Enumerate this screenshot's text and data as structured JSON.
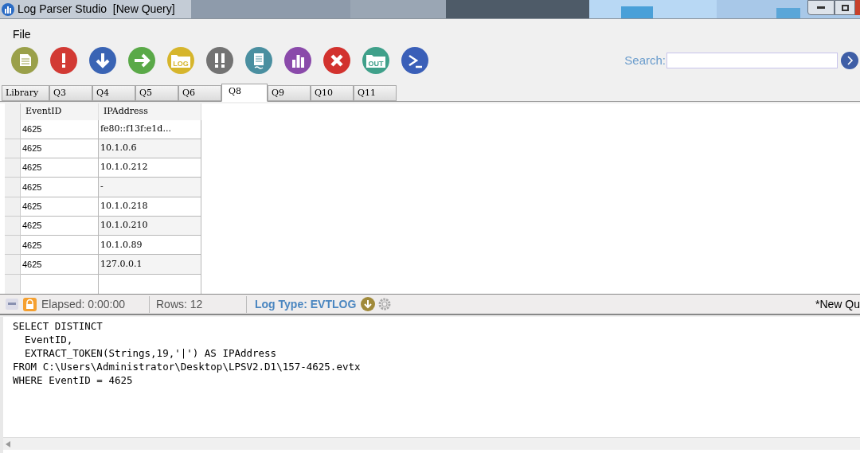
{
  "window": {
    "title": "Log Parser Studio  [New Query]"
  },
  "menu": [
    "File"
  ],
  "toolbar": [
    {
      "kind": "document",
      "color": "#9aa04a"
    },
    {
      "kind": "exclamation",
      "color": "#d23a34"
    },
    {
      "kind": "down-arrow",
      "color": "#3a64b4"
    },
    {
      "kind": "right-arrow",
      "color": "#5aa948"
    },
    {
      "kind": "folder",
      "color": "#d6b52c",
      "label": "LOG"
    },
    {
      "kind": "double-exclamation",
      "color": "#737373"
    },
    {
      "kind": "page",
      "color": "#4a8fa0"
    },
    {
      "kind": "bars",
      "color": "#8a4aaa"
    },
    {
      "kind": "x",
      "color": "#d2322e"
    },
    {
      "kind": "folder",
      "color": "#3fa08a",
      "label": "OUT"
    },
    {
      "kind": "prompt",
      "color": "#3a5fb8"
    }
  ],
  "search": {
    "label": "Search:"
  },
  "tabs": [
    {
      "label": "Library",
      "selected": false
    },
    {
      "label": "Q3",
      "selected": false
    },
    {
      "label": "Q4",
      "selected": false
    },
    {
      "label": "Q5",
      "selected": false
    },
    {
      "label": "Q6",
      "selected": false
    },
    {
      "label": "Q8",
      "selected": true
    },
    {
      "label": "Q9",
      "selected": false
    },
    {
      "label": "Q10",
      "selected": false
    },
    {
      "label": "Q11",
      "selected": false
    }
  ],
  "table": {
    "columns": [
      "EventID",
      "IPAddress"
    ],
    "rows": [
      [
        "4625",
        "fe80::f13f:e1d..."
      ],
      [
        "4625",
        "10.1.0.6"
      ],
      [
        "4625",
        "10.1.0.212"
      ],
      [
        "4625",
        "-"
      ],
      [
        "4625",
        "10.1.0.218"
      ],
      [
        "4625",
        "10.1.0.210"
      ],
      [
        "4625",
        "10.1.0.89"
      ],
      [
        "4625",
        "127.0.0.1"
      ]
    ]
  },
  "status_bar": {
    "elapsed": "Elapsed: 0:00:00",
    "rows": "Rows: 12",
    "log_type": "Log Type: EVTLOG",
    "query_name": "*New Qu"
  },
  "editor": {
    "lines": [
      "SELECT DISTINCT",
      "  EventID,",
      "  EXTRACT_TOKEN(Strings,19,'|') AS IPAddress",
      "FROM C:\\Users\\Administrator\\Desktop\\LPSV2.D1\\157-4625.evtx",
      "WHERE EventID = 4625"
    ]
  }
}
